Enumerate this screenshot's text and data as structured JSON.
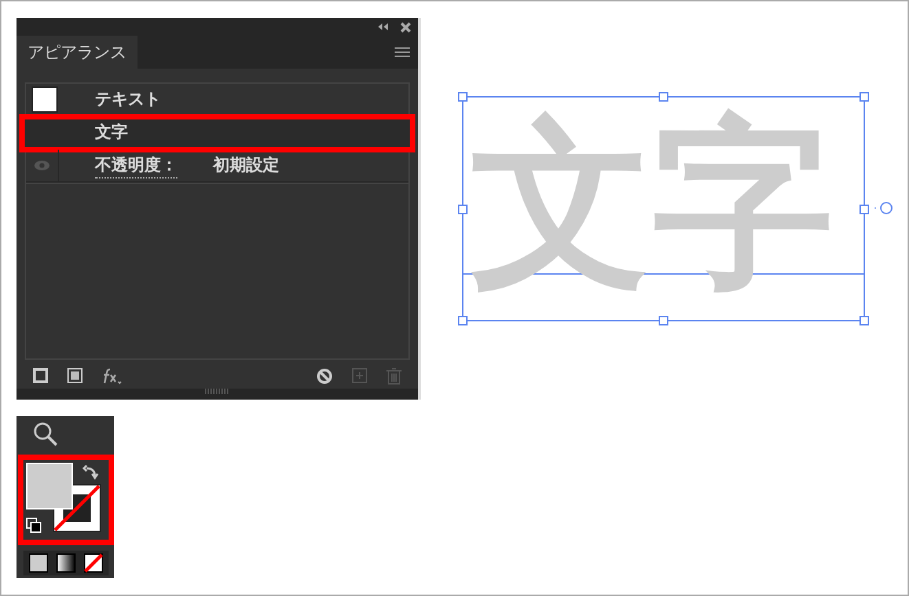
{
  "panel": {
    "tab": "アピアランス",
    "rows": [
      {
        "kind": "object",
        "label": "テキスト",
        "selected": false
      },
      {
        "kind": "attribute",
        "label": "文字",
        "selected": true
      },
      {
        "kind": "opacity",
        "label": "不透明度：",
        "value": "初期設定",
        "selected": false
      }
    ]
  },
  "canvas": {
    "text": "文字"
  }
}
